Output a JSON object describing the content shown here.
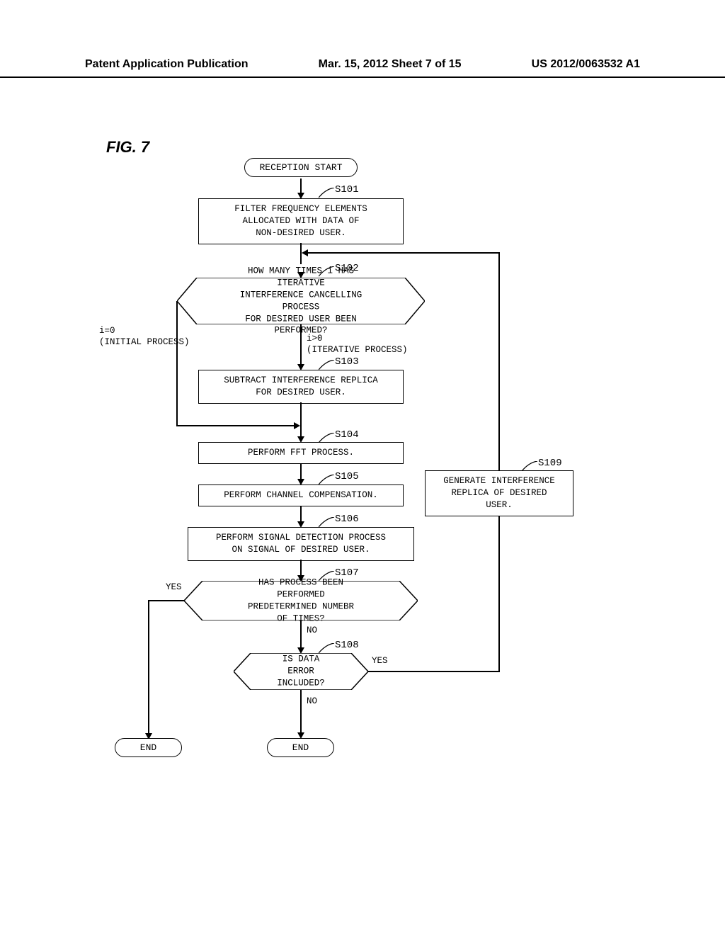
{
  "header": {
    "left": "Patent Application Publication",
    "center": "Mar. 15, 2012  Sheet 7 of 15",
    "right": "US 2012/0063532 A1"
  },
  "figure_label": "FIG. 7",
  "nodes": {
    "start": "RECEPTION START",
    "s101": "FILTER FREQUENCY ELEMENTS\nALLOCATED WITH DATA OF\nNON-DESIRED USER.",
    "s102": "HOW MANY TIMES i HAS ITERATIVE\nINTERFERENCE CANCELLING PROCESS\nFOR DESIRED USER BEEN PERFORMED?",
    "s103": "SUBTRACT INTERFERENCE REPLICA\nFOR DESIRED USER.",
    "s104": "PERFORM FFT PROCESS.",
    "s105": "PERFORM CHANNEL COMPENSATION.",
    "s106": "PERFORM SIGNAL DETECTION PROCESS\nON SIGNAL OF DESIRED USER.",
    "s107": "HAS PROCESS BEEN PERFORMED\nPREDETERMINED NUMEBR OF TIMES?",
    "s108": "IS DATA\nERROR INCLUDED?",
    "s109": "GENERATE INTERFERENCE\nREPLICA OF DESIRED USER.",
    "end1": "END",
    "end2": "END"
  },
  "step_labels": {
    "s101": "S101",
    "s102": "S102",
    "s103": "S103",
    "s104": "S104",
    "s105": "S105",
    "s106": "S106",
    "s107": "S107",
    "s108": "S108",
    "s109": "S109"
  },
  "edge_labels": {
    "i_zero": "i=0\n(INITIAL PROCESS)",
    "i_pos": "i>0\n(ITERATIVE PROCESS)",
    "s107_yes": "YES",
    "s107_no": "NO",
    "s108_yes": "YES",
    "s108_no": "NO"
  },
  "chart_data": {
    "type": "flowchart",
    "title": "FIG. 7",
    "nodes": [
      {
        "id": "start",
        "type": "terminal",
        "text": "RECEPTION START"
      },
      {
        "id": "S101",
        "type": "process",
        "text": "FILTER FREQUENCY ELEMENTS ALLOCATED WITH DATA OF NON-DESIRED USER."
      },
      {
        "id": "S102",
        "type": "decision",
        "text": "HOW MANY TIMES i HAS ITERATIVE INTERFERENCE CANCELLING PROCESS FOR DESIRED USER BEEN PERFORMED?"
      },
      {
        "id": "S103",
        "type": "process",
        "text": "SUBTRACT INTERFERENCE REPLICA FOR DESIRED USER."
      },
      {
        "id": "S104",
        "type": "process",
        "text": "PERFORM FFT PROCESS."
      },
      {
        "id": "S105",
        "type": "process",
        "text": "PERFORM CHANNEL COMPENSATION."
      },
      {
        "id": "S106",
        "type": "process",
        "text": "PERFORM SIGNAL DETECTION PROCESS ON SIGNAL OF DESIRED USER."
      },
      {
        "id": "S107",
        "type": "decision",
        "text": "HAS PROCESS BEEN PERFORMED PREDETERMINED NUMEBR OF TIMES?"
      },
      {
        "id": "S108",
        "type": "decision",
        "text": "IS DATA ERROR INCLUDED?"
      },
      {
        "id": "S109",
        "type": "process",
        "text": "GENERATE INTERFERENCE REPLICA OF DESIRED USER."
      },
      {
        "id": "end1",
        "type": "terminal",
        "text": "END"
      },
      {
        "id": "end2",
        "type": "terminal",
        "text": "END"
      }
    ],
    "edges": [
      {
        "from": "start",
        "to": "S101"
      },
      {
        "from": "S101",
        "to": "S102"
      },
      {
        "from": "S102",
        "to": "S103",
        "label": "i>0 (ITERATIVE PROCESS)"
      },
      {
        "from": "S102",
        "to": "S104",
        "label": "i=0 (INITIAL PROCESS)"
      },
      {
        "from": "S103",
        "to": "S104"
      },
      {
        "from": "S104",
        "to": "S105"
      },
      {
        "from": "S105",
        "to": "S106"
      },
      {
        "from": "S106",
        "to": "S107"
      },
      {
        "from": "S107",
        "to": "end1",
        "label": "YES"
      },
      {
        "from": "S107",
        "to": "S108",
        "label": "NO"
      },
      {
        "from": "S108",
        "to": "end2",
        "label": "NO"
      },
      {
        "from": "S108",
        "to": "S109",
        "label": "YES"
      },
      {
        "from": "S109",
        "to": "S102",
        "note": "loop back to before S102"
      }
    ]
  }
}
